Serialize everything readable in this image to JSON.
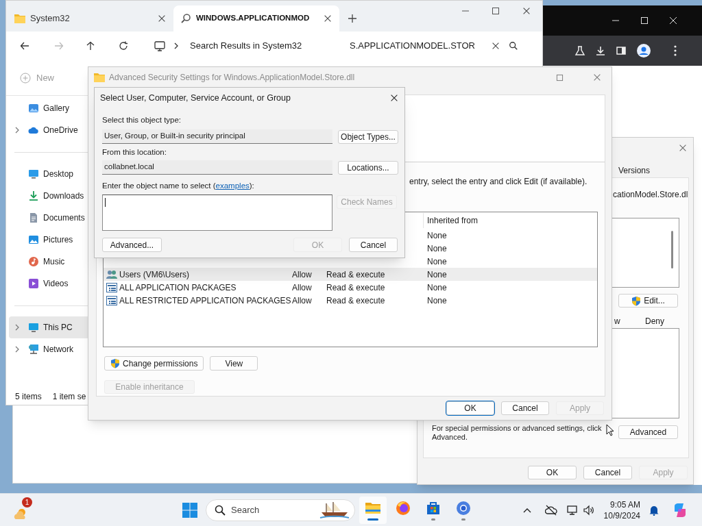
{
  "explorer": {
    "tabs": [
      {
        "label": "System32",
        "kind": "folder",
        "selected": false
      },
      {
        "label": "WINDOWS.APPLICATIONMOD",
        "kind": "search",
        "selected": true
      }
    ],
    "location": "Search Results in System32",
    "search_value": "S.APPLICATIONMODEL.STOR",
    "new_button": "New",
    "sidebar": {
      "groups": [
        [
          {
            "label": "Gallery",
            "kind": "gallery",
            "expandable": false,
            "selected": false
          },
          {
            "label": "OneDrive",
            "kind": "cloud",
            "expandable": true,
            "selected": false
          }
        ],
        [
          {
            "label": "Desktop",
            "kind": "desktop",
            "expandable": false,
            "selected": false
          },
          {
            "label": "Downloads",
            "kind": "downloads",
            "expandable": false,
            "selected": false
          },
          {
            "label": "Documents",
            "kind": "documents",
            "expandable": false,
            "selected": false
          },
          {
            "label": "Pictures",
            "kind": "pictures",
            "expandable": false,
            "selected": false
          },
          {
            "label": "Music",
            "kind": "music",
            "expandable": false,
            "selected": false
          },
          {
            "label": "Videos",
            "kind": "videos",
            "expandable": false,
            "selected": false
          }
        ],
        [
          {
            "label": "This PC",
            "kind": "pc",
            "expandable": true,
            "selected": true
          },
          {
            "label": "Network",
            "kind": "network",
            "expandable": true,
            "selected": false
          }
        ]
      ]
    },
    "status_bar": [
      "5 items",
      "1 item se"
    ]
  },
  "properties": {
    "tab_fragment": "Versions",
    "file_fragment": "cationModel.Store.dl",
    "edit_button": "Edit...",
    "permission_columns": [
      "w",
      "Deny"
    ],
    "note": "For special permissions or advanced settings, click Advanced.",
    "advanced_button": "Advanced",
    "footer": [
      {
        "label": "OK",
        "disabled": false
      },
      {
        "label": "Cancel",
        "disabled": false
      },
      {
        "label": "Apply",
        "disabled": true
      }
    ]
  },
  "advanced_security": {
    "title": "Advanced Security Settings for Windows.ApplicationModel.Store.dll",
    "instruction": "entry, select the entry and click Edit (if available).",
    "table": {
      "column": "Inherited from",
      "rows": [
        {
          "inherited_from": "None",
          "selected": false
        },
        {
          "inherited_from": "None",
          "selected": false
        },
        {
          "inherited_from": "None",
          "selected": false
        },
        {
          "kind": "users",
          "principal": "Users (VM6\\Users)",
          "type": "Allow",
          "access": "Read & execute",
          "inherited_from": "None",
          "selected": true
        },
        {
          "kind": "package",
          "principal": "ALL APPLICATION PACKAGES",
          "type": "Allow",
          "access": "Read & execute",
          "inherited_from": "None",
          "selected": false
        },
        {
          "kind": "package",
          "principal": "ALL RESTRICTED APPLICATION PACKAGES",
          "type": "Allow",
          "access": "Read & execute",
          "inherited_from": "None",
          "selected": false
        }
      ]
    },
    "buttons": [
      {
        "label": "Change permissions",
        "kind": "shield"
      },
      {
        "label": "View",
        "kind": "plain"
      }
    ],
    "enable_inheritance": {
      "label": "Enable inheritance",
      "disabled": true
    },
    "footer": [
      {
        "label": "OK",
        "default": true,
        "disabled": false
      },
      {
        "label": "Cancel",
        "default": false,
        "disabled": false
      },
      {
        "label": "Apply",
        "default": false,
        "disabled": true
      }
    ]
  },
  "select_dialog": {
    "title": "Select User, Computer, Service Account, or Group",
    "object_type_label": "Select this object type:",
    "object_type": "User, Group, or Built-in security principal",
    "object_types_button": "Object Types...",
    "location_label": "From this location:",
    "location": "collabnet.local",
    "locations_button": "Locations...",
    "name_prompt": {
      "before": "Enter the object name to select (",
      "link": "examples",
      "after": "):"
    },
    "check_names": {
      "label": "Check Names",
      "disabled": true
    },
    "advanced_button": "Advanced...",
    "buttons": [
      {
        "label": "OK",
        "disabled": true
      },
      {
        "label": "Cancel",
        "disabled": false
      }
    ]
  },
  "taskbar": {
    "weather_badge": "1",
    "search_placeholder": "Search",
    "apps": [
      {
        "kind": "file-explorer",
        "active": true,
        "running": true
      },
      {
        "kind": "firefox",
        "active": false,
        "running": false
      },
      {
        "kind": "store",
        "active": false,
        "running": true
      },
      {
        "kind": "browser",
        "active": false,
        "running": true
      }
    ],
    "time": "9:05 AM",
    "date": "10/9/2024"
  }
}
